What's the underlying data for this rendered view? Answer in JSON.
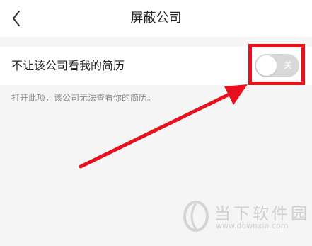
{
  "header": {
    "back_icon": "chevron-left-icon",
    "title": "屏蔽公司"
  },
  "setting": {
    "label": "不让该公司看我的简历",
    "toggle": {
      "state_text": "关",
      "is_on": false,
      "track_color": "#d8d8d8",
      "knob_color": "#ffffff"
    }
  },
  "hint": "打开此项，该公司无法查看你的简历。",
  "annotation": {
    "color": "#e8101c"
  },
  "watermark": {
    "name": "当下软件园",
    "url": "www.downxia.com"
  }
}
